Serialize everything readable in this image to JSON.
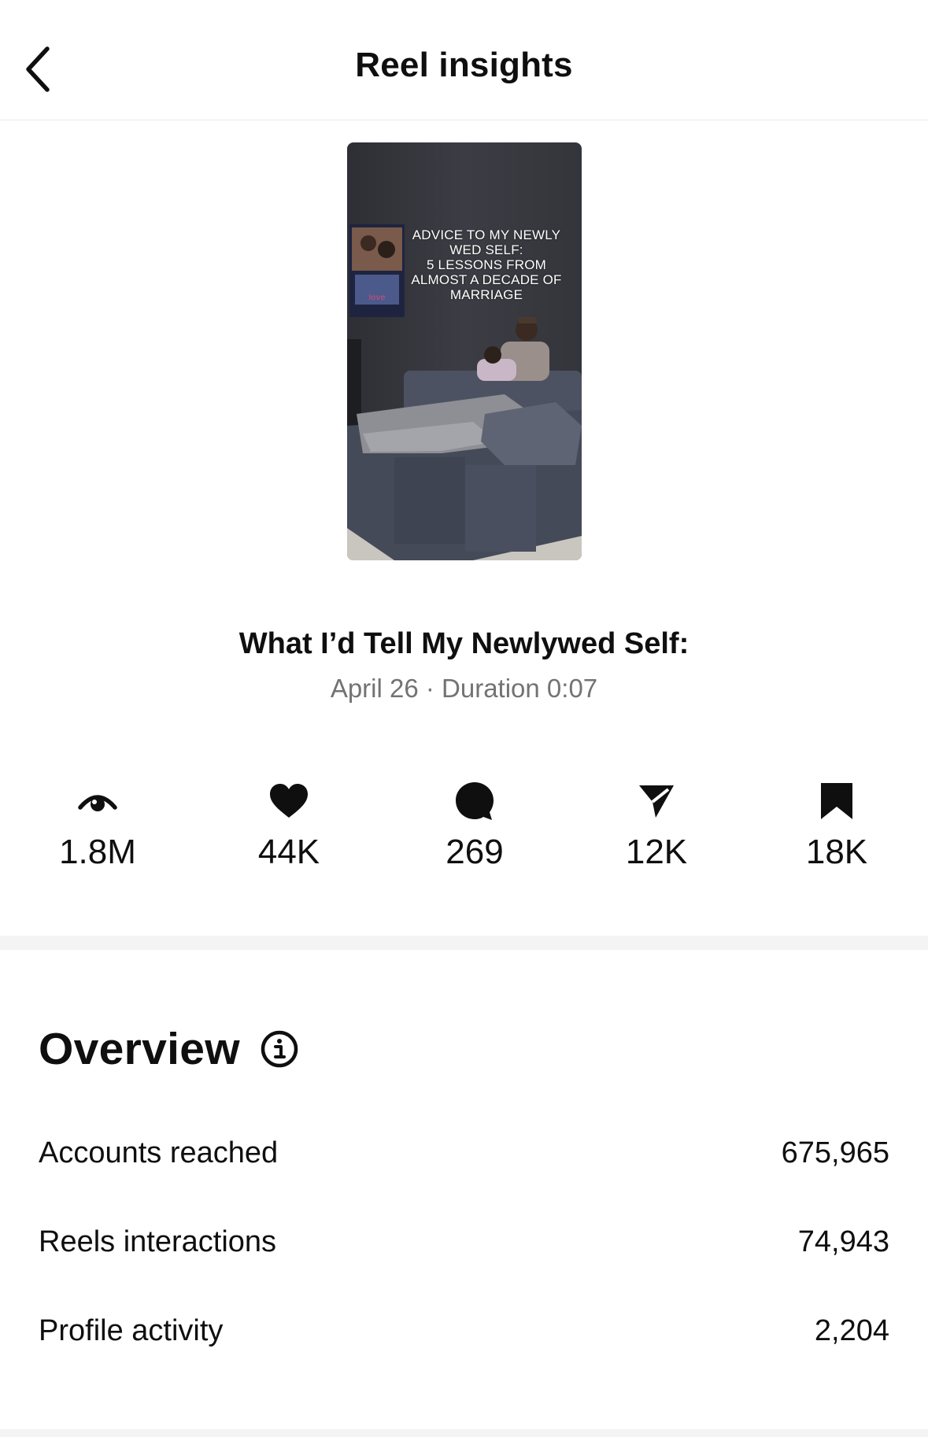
{
  "header": {
    "title": "Reel insights",
    "back_icon": "chevron-left-icon"
  },
  "reel": {
    "thumbnail_caption": "ADVICE TO MY NEWLY\nWED SELF:\n5 LESSONS FROM\nALMOST A DECADE OF\nMARRIAGE",
    "title": "What I’d Tell My Newlywed Self:",
    "meta": "April 26 · Duration 0:07"
  },
  "stats": [
    {
      "icon": "views-eye-icon",
      "value": "1.8M"
    },
    {
      "icon": "heart-icon",
      "value": "44K"
    },
    {
      "icon": "comment-icon",
      "value": "269"
    },
    {
      "icon": "share-icon",
      "value": "12K"
    },
    {
      "icon": "bookmark-icon",
      "value": "18K"
    }
  ],
  "overview": {
    "title": "Overview",
    "info_icon": "info-icon",
    "rows": [
      {
        "label": "Accounts reached",
        "value": "675,965"
      },
      {
        "label": "Reels interactions",
        "value": "74,943"
      },
      {
        "label": "Profile activity",
        "value": "2,204"
      }
    ]
  }
}
